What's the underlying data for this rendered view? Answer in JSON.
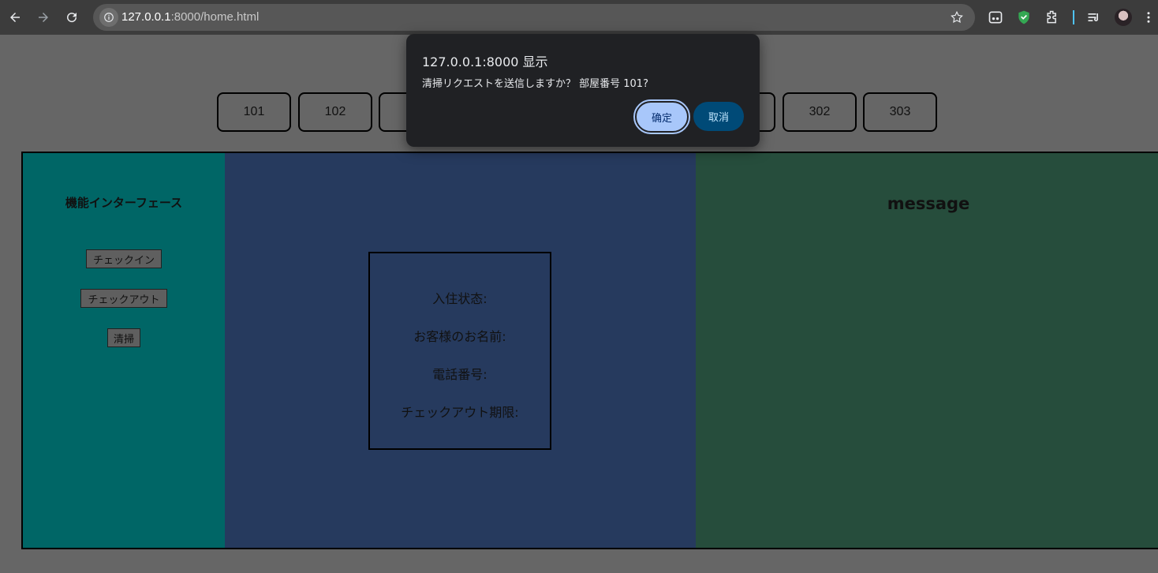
{
  "browser": {
    "url_host": "127.0.0.1",
    "url_rest": ":8000/home.html",
    "icons": [
      "back-icon",
      "forward-icon",
      "reload-icon",
      "site-info-icon",
      "bookmark-star-icon",
      "extension-icon",
      "shield-extension-icon",
      "puzzle-extensions-icon",
      "reading-list-icon",
      "profile-avatar",
      "menu-icon"
    ]
  },
  "rooms": [
    "101",
    "102",
    "",
    "",
    "",
    "",
    "302",
    "303"
  ],
  "functions": {
    "title": "機能インターフェース",
    "checkin": "チェックイン",
    "checkout": "チェックアウト",
    "clean": "清掃"
  },
  "info": {
    "status_label": "入住状态:",
    "name_label": "お客様のお名前:",
    "phone_label": "電話番号:",
    "deadline_label": "チェックアウト期限:"
  },
  "message": {
    "title": "message"
  },
  "dialog": {
    "title": "127.0.0.1:8000 显示",
    "text": "清掃リクエストを送信しますか？ 部屋番号 101?",
    "ok": "确定",
    "cancel": "取消"
  },
  "colors": {
    "page_bg": "#666666",
    "left_panel": "#006666",
    "mid_panel": "#263a5e",
    "right_panel": "#264d3c",
    "dialog_bg": "#202124",
    "ok_button": "#a8c7fa",
    "cancel_button": "#004a77"
  }
}
